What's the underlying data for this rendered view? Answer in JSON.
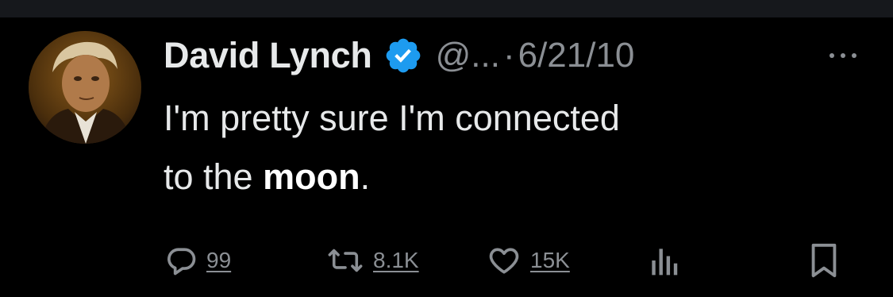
{
  "tweet": {
    "author_name": "David Lynch",
    "handle": "@...",
    "separator": "·",
    "date": "6/21/10",
    "body_line1": "I'm pretty sure I'm connected",
    "body_line2_prefix": "to the ",
    "body_bold": "moon",
    "body_suffix": "."
  },
  "actions": {
    "replies": "99",
    "reposts": "8.1K",
    "likes": "15K"
  },
  "icons": {
    "verified": "verified-badge-icon",
    "more": "more-options-icon",
    "reply": "reply-icon",
    "repost": "repost-icon",
    "like": "heart-icon",
    "views": "analytics-icon",
    "bookmark": "bookmark-icon"
  },
  "colors": {
    "background": "#000000",
    "text": "#e7e9ea",
    "secondary": "#8b8f94",
    "verified": "#1d9bf0"
  }
}
